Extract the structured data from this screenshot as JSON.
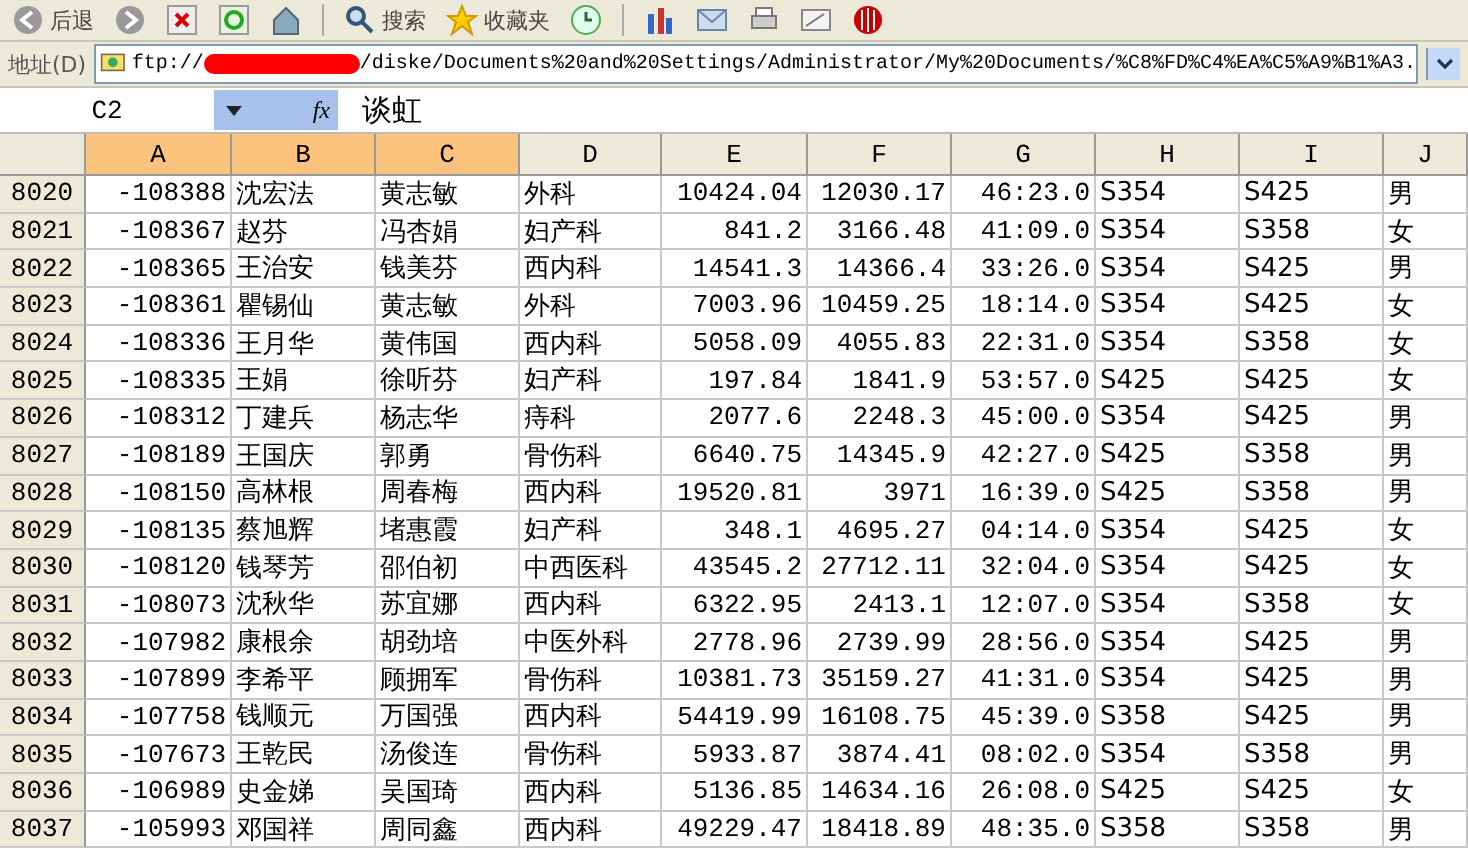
{
  "toolbar": {
    "back_label": "后退",
    "search_label": "搜索",
    "favorites_label": "收藏夹"
  },
  "address_bar": {
    "label": "地址(D)",
    "url_prefix": "ftp://",
    "url_rest": "/diske/Documents%20and%20Settings/Administrator/My%20Documents/%C8%FD%C4%EA%C5%A9%B1%A3."
  },
  "formula_bar": {
    "name_box": "C2",
    "function_label": "fx",
    "value": "谈虹"
  },
  "sheet": {
    "columns": [
      {
        "label": "A",
        "selected": true,
        "kind": "number"
      },
      {
        "label": "B",
        "selected": true,
        "kind": "text"
      },
      {
        "label": "C",
        "selected": true,
        "kind": "text"
      },
      {
        "label": "D",
        "selected": false,
        "kind": "text"
      },
      {
        "label": "E",
        "selected": false,
        "kind": "number"
      },
      {
        "label": "F",
        "selected": false,
        "kind": "number"
      },
      {
        "label": "G",
        "selected": false,
        "kind": "number"
      },
      {
        "label": "H",
        "selected": false,
        "kind": "text"
      },
      {
        "label": "I",
        "selected": false,
        "kind": "text"
      },
      {
        "label": "J",
        "selected": false,
        "kind": "text"
      }
    ],
    "rows": [
      {
        "number": "8020",
        "cells": [
          "-108388",
          "沈宏法",
          "黄志敏",
          "外科",
          "10424.04",
          "12030.17",
          "46:23.0",
          "S354",
          "S425",
          "男"
        ]
      },
      {
        "number": "8021",
        "cells": [
          "-108367",
          "赵芬",
          "冯杏娟",
          "妇产科",
          "841.2",
          "3166.48",
          "41:09.0",
          "S354",
          "S358",
          "女"
        ]
      },
      {
        "number": "8022",
        "cells": [
          "-108365",
          "王治安",
          "钱美芬",
          "西内科",
          "14541.3",
          "14366.4",
          "33:26.0",
          "S354",
          "S425",
          "男"
        ]
      },
      {
        "number": "8023",
        "cells": [
          "-108361",
          "瞿锡仙",
          "黄志敏",
          "外科",
          "7003.96",
          "10459.25",
          "18:14.0",
          "S354",
          "S425",
          "女"
        ]
      },
      {
        "number": "8024",
        "cells": [
          "-108336",
          "王月华",
          "黄伟国",
          "西内科",
          "5058.09",
          "4055.83",
          "22:31.0",
          "S354",
          "S358",
          "女"
        ]
      },
      {
        "number": "8025",
        "cells": [
          "-108335",
          "王娟",
          "徐听芬",
          "妇产科",
          "197.84",
          "1841.9",
          "53:57.0",
          "S425",
          "S425",
          "女"
        ]
      },
      {
        "number": "8026",
        "cells": [
          "-108312",
          "丁建兵",
          "杨志华",
          "痔科",
          "2077.6",
          "2248.3",
          "45:00.0",
          "S354",
          "S425",
          "男"
        ]
      },
      {
        "number": "8027",
        "cells": [
          "-108189",
          "王国庆",
          "郭勇",
          "骨伤科",
          "6640.75",
          "14345.9",
          "42:27.0",
          "S425",
          "S358",
          "男"
        ]
      },
      {
        "number": "8028",
        "cells": [
          "-108150",
          "高林根",
          "周春梅",
          "西内科",
          "19520.81",
          "3971",
          "16:39.0",
          "S425",
          "S358",
          "男"
        ]
      },
      {
        "number": "8029",
        "cells": [
          "-108135",
          "蔡旭辉",
          "堵惠霞",
          "妇产科",
          "348.1",
          "4695.27",
          "04:14.0",
          "S354",
          "S425",
          "女"
        ]
      },
      {
        "number": "8030",
        "cells": [
          "-108120",
          "钱琴芳",
          "邵伯初",
          "中西医科",
          "43545.2",
          "27712.11",
          "32:04.0",
          "S354",
          "S425",
          "女"
        ]
      },
      {
        "number": "8031",
        "cells": [
          "-108073",
          "沈秋华",
          "苏宜娜",
          "西内科",
          "6322.95",
          "2413.1",
          "12:07.0",
          "S354",
          "S358",
          "女"
        ]
      },
      {
        "number": "8032",
        "cells": [
          "-107982",
          "康根余",
          "胡劲培",
          "中医外科",
          "2778.96",
          "2739.99",
          "28:56.0",
          "S354",
          "S425",
          "男"
        ]
      },
      {
        "number": "8033",
        "cells": [
          "-107899",
          "李希平",
          "顾拥军",
          "骨伤科",
          "10381.73",
          "35159.27",
          "41:31.0",
          "S354",
          "S425",
          "男"
        ]
      },
      {
        "number": "8034",
        "cells": [
          "-107758",
          "钱顺元",
          "万国强",
          "西内科",
          "54419.99",
          "16108.75",
          "45:39.0",
          "S358",
          "S425",
          "男"
        ]
      },
      {
        "number": "8035",
        "cells": [
          "-107673",
          "王乾民",
          "汤俊连",
          "骨伤科",
          "5933.87",
          "3874.41",
          "08:02.0",
          "S354",
          "S358",
          "男"
        ]
      },
      {
        "number": "8036",
        "cells": [
          "-106989",
          "史金娣",
          "吴国琦",
          "西内科",
          "5136.85",
          "14634.16",
          "26:08.0",
          "S425",
          "S425",
          "女"
        ]
      },
      {
        "number": "8037",
        "cells": [
          "-105993",
          "邓国祥",
          "周同鑫",
          "西内科",
          "49229.47",
          "18418.89",
          "48:35.0",
          "S358",
          "S358",
          "男"
        ]
      }
    ]
  }
}
